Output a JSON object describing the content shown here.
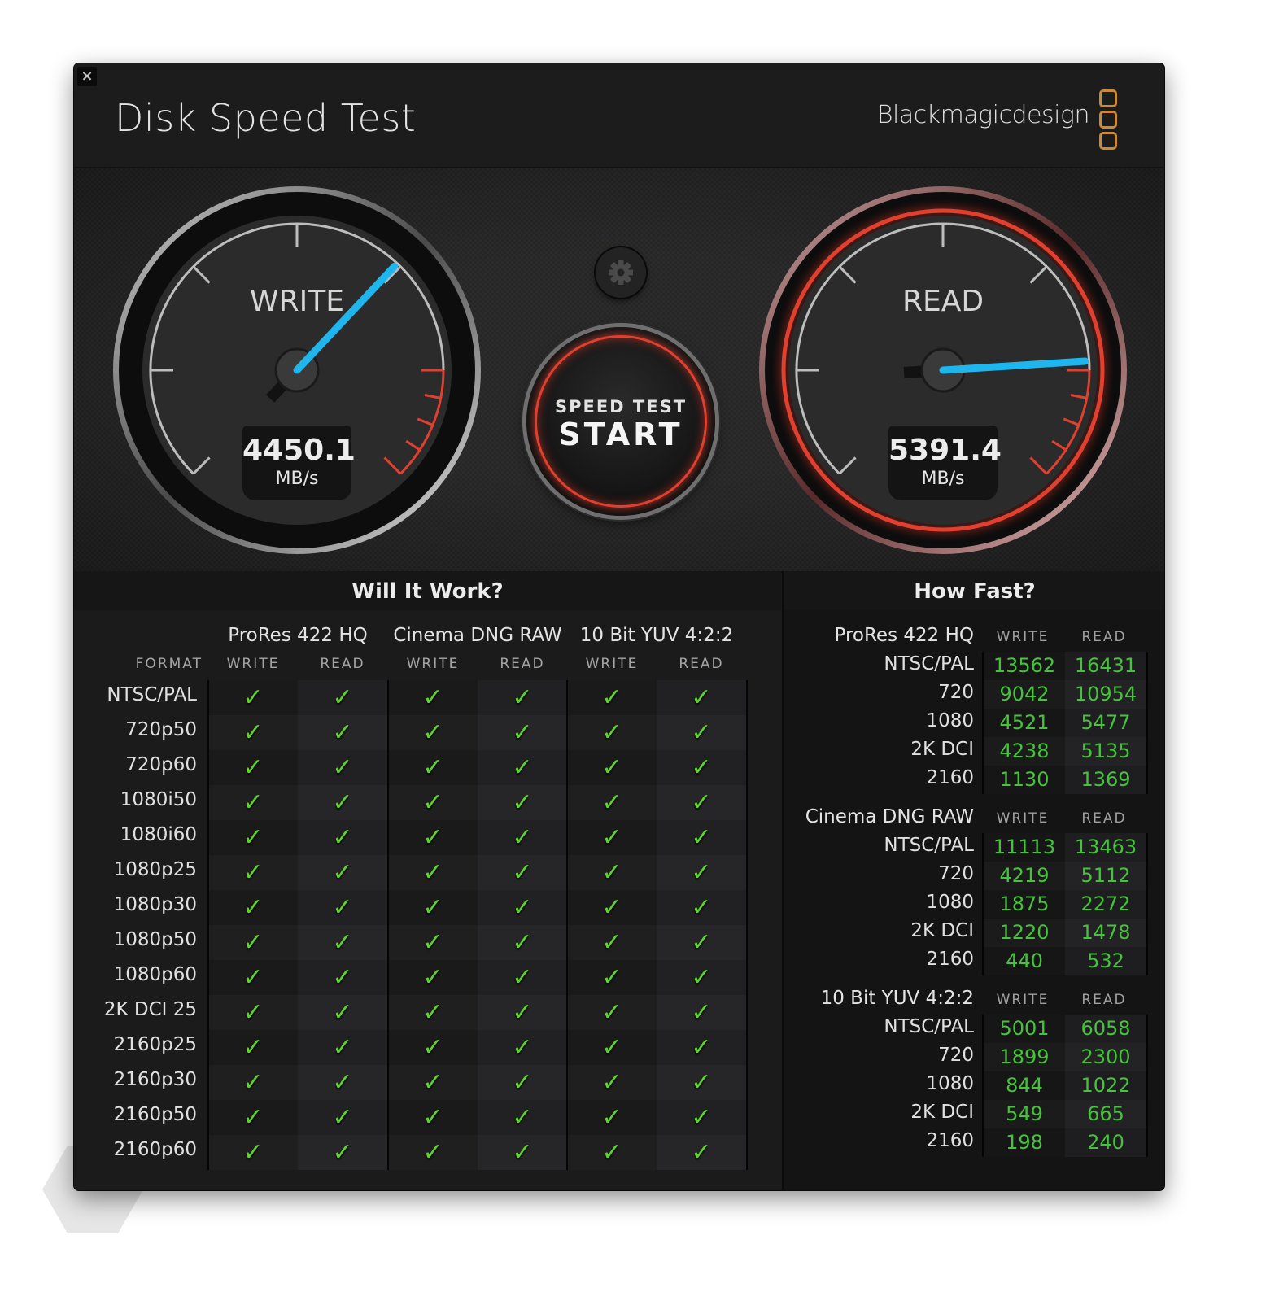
{
  "window": {
    "title": "Disk Speed Test",
    "brand": "Blackmagicdesign",
    "close_icon": "×"
  },
  "gauges": {
    "write": {
      "label": "WRITE",
      "value": "4450.1",
      "unit": "MB/s",
      "needle_fraction": 0.66
    },
    "read": {
      "label": "READ",
      "value": "5391.4",
      "unit": "MB/s",
      "needle_fraction": 0.82
    }
  },
  "controls": {
    "settings_icon": "gear-icon",
    "start_line1": "SPEED TEST",
    "start_line2": "START"
  },
  "colors": {
    "needle": "#1fb6ee",
    "redline": "#e0402f",
    "check": "#5fd42b",
    "speed_value": "#45c33a",
    "logo": "#c98b3a"
  },
  "will_it_work": {
    "title": "Will It Work?",
    "format_label": "FORMAT",
    "codecs": [
      "ProRes 422 HQ",
      "Cinema DNG RAW",
      "10 Bit YUV 4:2:2"
    ],
    "sub_labels": [
      "WRITE",
      "READ",
      "WRITE",
      "READ",
      "WRITE",
      "READ"
    ],
    "check_glyph": "✓",
    "formats": [
      {
        "name": "NTSC/PAL",
        "checks": [
          true,
          true,
          true,
          true,
          true,
          true
        ]
      },
      {
        "name": "720p50",
        "checks": [
          true,
          true,
          true,
          true,
          true,
          true
        ]
      },
      {
        "name": "720p60",
        "checks": [
          true,
          true,
          true,
          true,
          true,
          true
        ]
      },
      {
        "name": "1080i50",
        "checks": [
          true,
          true,
          true,
          true,
          true,
          true
        ]
      },
      {
        "name": "1080i60",
        "checks": [
          true,
          true,
          true,
          true,
          true,
          true
        ]
      },
      {
        "name": "1080p25",
        "checks": [
          true,
          true,
          true,
          true,
          true,
          true
        ]
      },
      {
        "name": "1080p30",
        "checks": [
          true,
          true,
          true,
          true,
          true,
          true
        ]
      },
      {
        "name": "1080p50",
        "checks": [
          true,
          true,
          true,
          true,
          true,
          true
        ]
      },
      {
        "name": "1080p60",
        "checks": [
          true,
          true,
          true,
          true,
          true,
          true
        ]
      },
      {
        "name": "2K DCI 25",
        "checks": [
          true,
          true,
          true,
          true,
          true,
          true
        ]
      },
      {
        "name": "2160p25",
        "checks": [
          true,
          true,
          true,
          true,
          true,
          true
        ]
      },
      {
        "name": "2160p30",
        "checks": [
          true,
          true,
          true,
          true,
          true,
          true
        ]
      },
      {
        "name": "2160p50",
        "checks": [
          true,
          true,
          true,
          true,
          true,
          true
        ]
      },
      {
        "name": "2160p60",
        "checks": [
          true,
          true,
          true,
          true,
          true,
          true
        ]
      }
    ]
  },
  "how_fast": {
    "title": "How Fast?",
    "write_label": "WRITE",
    "read_label": "READ",
    "groups": [
      {
        "codec": "ProRes 422 HQ",
        "rows": [
          {
            "res": "NTSC/PAL",
            "write": "13562",
            "read": "16431"
          },
          {
            "res": "720",
            "write": "9042",
            "read": "10954"
          },
          {
            "res": "1080",
            "write": "4521",
            "read": "5477"
          },
          {
            "res": "2K DCI",
            "write": "4238",
            "read": "5135"
          },
          {
            "res": "2160",
            "write": "1130",
            "read": "1369"
          }
        ]
      },
      {
        "codec": "Cinema DNG RAW",
        "rows": [
          {
            "res": "NTSC/PAL",
            "write": "11113",
            "read": "13463"
          },
          {
            "res": "720",
            "write": "4219",
            "read": "5112"
          },
          {
            "res": "1080",
            "write": "1875",
            "read": "2272"
          },
          {
            "res": "2K DCI",
            "write": "1220",
            "read": "1478"
          },
          {
            "res": "2160",
            "write": "440",
            "read": "532"
          }
        ]
      },
      {
        "codec": "10 Bit YUV 4:2:2",
        "rows": [
          {
            "res": "NTSC/PAL",
            "write": "5001",
            "read": "6058"
          },
          {
            "res": "720",
            "write": "1899",
            "read": "2300"
          },
          {
            "res": "1080",
            "write": "844",
            "read": "1022"
          },
          {
            "res": "2K DCI",
            "write": "549",
            "read": "665"
          },
          {
            "res": "2160",
            "write": "198",
            "read": "240"
          }
        ]
      }
    ]
  }
}
